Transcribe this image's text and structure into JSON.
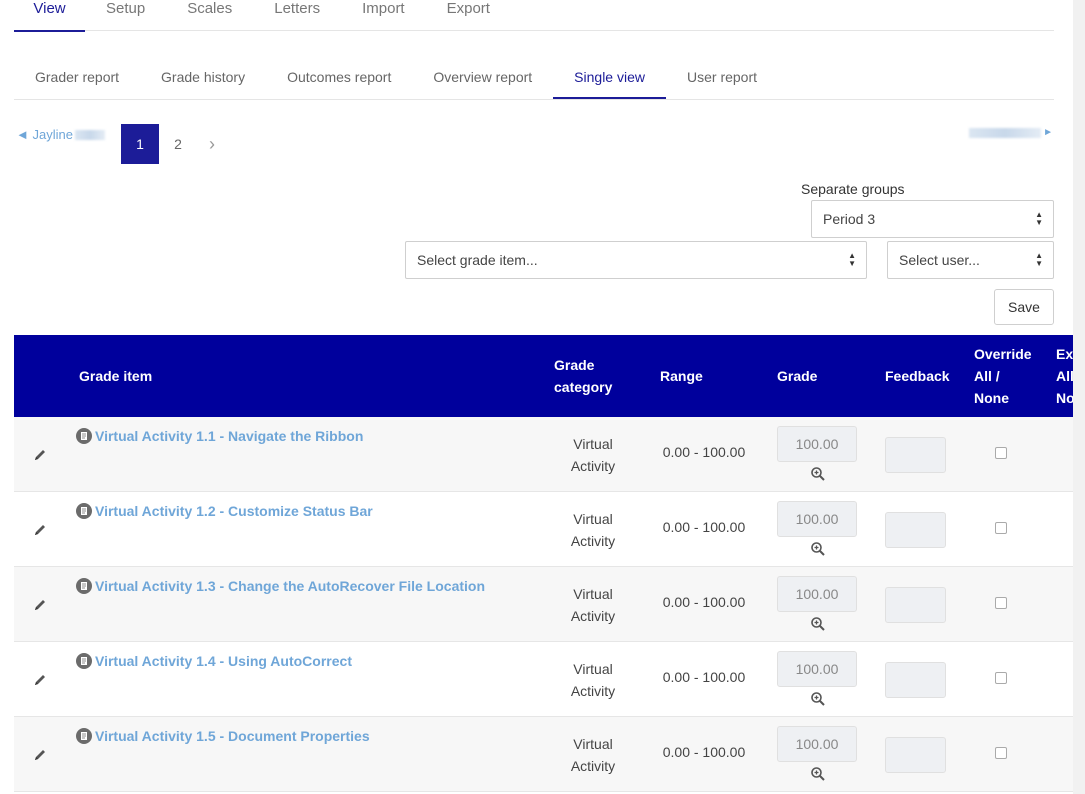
{
  "top_tabs": [
    "View",
    "Setup",
    "Scales",
    "Letters",
    "Import",
    "Export"
  ],
  "sub_tabs": [
    "Grader report",
    "Grade history",
    "Outcomes report",
    "Overview report",
    "Single view",
    "User report"
  ],
  "active_top_tab": "View",
  "active_sub_tab": "Single view",
  "nav": {
    "prev_user": "◄ Jayline",
    "next_arrow": "►"
  },
  "pagination": {
    "pages": [
      "1",
      "2"
    ],
    "current": "1",
    "next": "›"
  },
  "group": {
    "label": "Separate groups",
    "value": "Period 3"
  },
  "selects": {
    "grade_item": "Select grade item...",
    "user": "Select user..."
  },
  "save_label": "Save",
  "table": {
    "headers": {
      "grade_item": "Grade item",
      "grade_category_1": "Grade",
      "grade_category_2": "category",
      "range": "Range",
      "grade": "Grade",
      "feedback": "Feedback",
      "override_1": "Override",
      "override_2": "All /",
      "override_3": "None",
      "exclude_1": "Exc",
      "exclude_2": "All",
      "exclude_3": "No"
    },
    "rows": [
      {
        "item": "Virtual Activity 1.1 - Navigate the Ribbon",
        "category_1": "Virtual",
        "category_2": "Activity",
        "range": "0.00 - 100.00",
        "grade": "100.00"
      },
      {
        "item": "Virtual Activity 1.2 - Customize Status Bar",
        "category_1": "Virtual",
        "category_2": "Activity",
        "range": "0.00 - 100.00",
        "grade": "100.00"
      },
      {
        "item": "Virtual Activity 1.3 - Change the AutoRecover File Location",
        "category_1": "Virtual",
        "category_2": "Activity",
        "range": "0.00 - 100.00",
        "grade": "100.00"
      },
      {
        "item": "Virtual Activity 1.4 - Using AutoCorrect",
        "category_1": "Virtual",
        "category_2": "Activity",
        "range": "0.00 - 100.00",
        "grade": "100.00"
      },
      {
        "item": "Virtual Activity 1.5 - Document Properties",
        "category_1": "Virtual",
        "category_2": "Activity",
        "range": "0.00 - 100.00",
        "grade": "100.00"
      }
    ]
  },
  "colors": {
    "header_bg": "#00009c",
    "accent": "#1c1c98",
    "link": "#6fa6d8"
  }
}
